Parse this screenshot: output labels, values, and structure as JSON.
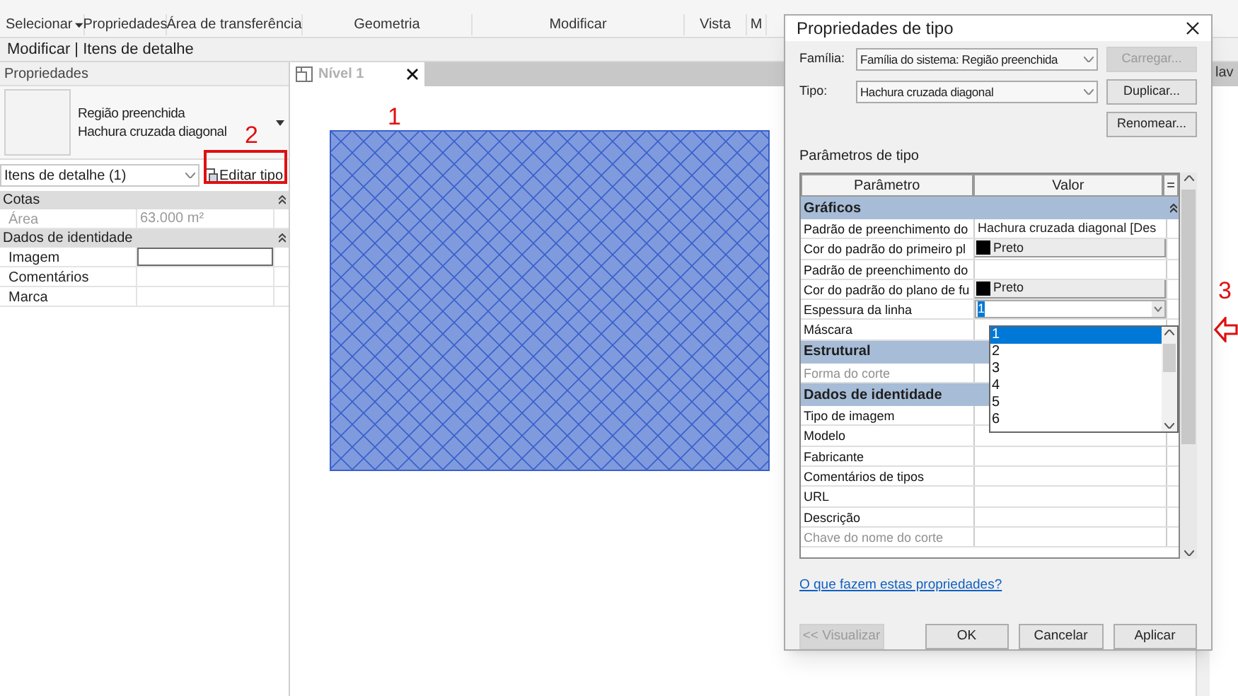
{
  "ribbon": {
    "groups": [
      {
        "label": "Selecionar",
        "dropdown": true
      },
      {
        "label": "Propriedades"
      },
      {
        "label": "Área de transferência"
      },
      {
        "label": "Geometria"
      },
      {
        "label": "Modificar"
      },
      {
        "label": "Vista"
      },
      {
        "label": "M"
      }
    ]
  },
  "context_bar": "Modificar | Itens de detalhe",
  "properties_panel": {
    "title": "Propriedades",
    "type_selector": {
      "family": "Região preenchida",
      "type": "Hachura cruzada diagonal"
    },
    "filter": "Itens de detalhe (1)",
    "edit_type_button": "Editar tipo",
    "groups": [
      {
        "title": "Cotas",
        "rows": [
          {
            "label": "Área",
            "value": "63.000 m²",
            "kind": "text",
            "disabled": true
          }
        ]
      },
      {
        "title": "Dados de identidade",
        "rows": [
          {
            "label": "Imagem",
            "kind": "field",
            "disabled": false
          },
          {
            "label": "Comentários",
            "kind": "text",
            "disabled": false
          },
          {
            "label": "Marca",
            "kind": "text",
            "disabled": false
          }
        ]
      }
    ]
  },
  "view_tab": {
    "label": "Nível 1"
  },
  "background_text": "lav",
  "annotations": [
    {
      "text": "1"
    },
    {
      "text": "2"
    },
    {
      "text": "3"
    }
  ],
  "dialog": {
    "title": "Propriedades de tipo",
    "fields": [
      {
        "label": "Família:",
        "value": "Família do sistema: Região preenchida"
      },
      {
        "label": "Tipo:",
        "value": "Hachura cruzada diagonal"
      }
    ],
    "buttons": [
      {
        "label": "Carregar...",
        "disabled": true
      },
      {
        "label": "Duplicar...",
        "disabled": false
      },
      {
        "label": "Renomear...",
        "disabled": false
      }
    ],
    "section_title": "Parâmetros de tipo",
    "table": {
      "columns": [
        "Parâmetro",
        "Valor",
        "="
      ],
      "groups": [
        {
          "title": "Gráficos",
          "rows": [
            {
              "label": "Padrão de preenchimento do",
              "kind": "text",
              "value": "Hachura cruzada diagonal [Des",
              "disabled": false
            },
            {
              "label": "Cor do padrão do primeiro pl",
              "kind": "color",
              "value": "Preto",
              "disabled": false
            },
            {
              "label": "Padrão de preenchimento do",
              "kind": "text",
              "disabled": false
            },
            {
              "label": "Cor do padrão do plano de fu",
              "kind": "color",
              "value": "Preto",
              "disabled": false
            },
            {
              "label": "Espessura da linha",
              "kind": "dropdown",
              "value": "1",
              "disabled": false,
              "dropdown": {
                "options": [
                  {
                    "label": "1",
                    "selected": true
                  },
                  {
                    "label": "2",
                    "selected": false
                  },
                  {
                    "label": "3",
                    "selected": false
                  },
                  {
                    "label": "4",
                    "selected": false
                  },
                  {
                    "label": "5",
                    "selected": false
                  },
                  {
                    "label": "6",
                    "selected": false
                  }
                ]
              }
            },
            {
              "label": "Máscara",
              "kind": "text",
              "disabled": false
            }
          ]
        },
        {
          "title": "Estrutural",
          "rows": [
            {
              "label": "Forma do corte",
              "kind": "text",
              "disabled": true
            }
          ]
        },
        {
          "title": "Dados de identidade",
          "rows": [
            {
              "label": "Tipo de imagem",
              "kind": "text",
              "disabled": false
            },
            {
              "label": "Modelo",
              "kind": "text",
              "disabled": false
            },
            {
              "label": "Fabricante",
              "kind": "text",
              "disabled": false
            },
            {
              "label": "Comentários de tipos",
              "kind": "text",
              "disabled": false
            },
            {
              "label": "URL",
              "kind": "text",
              "disabled": false
            },
            {
              "label": "Descrição",
              "kind": "text",
              "disabled": false
            },
            {
              "label": "Chave do nome do corte",
              "kind": "text",
              "disabled": true
            }
          ]
        }
      ]
    },
    "help_link": "O que fazem estas propriedades?",
    "footer_buttons": [
      {
        "label": "<< Visualizar",
        "disabled": true
      },
      {
        "label": "OK",
        "disabled": false
      },
      {
        "label": "Cancelar",
        "disabled": false
      },
      {
        "label": "Aplicar",
        "disabled": false
      }
    ]
  }
}
